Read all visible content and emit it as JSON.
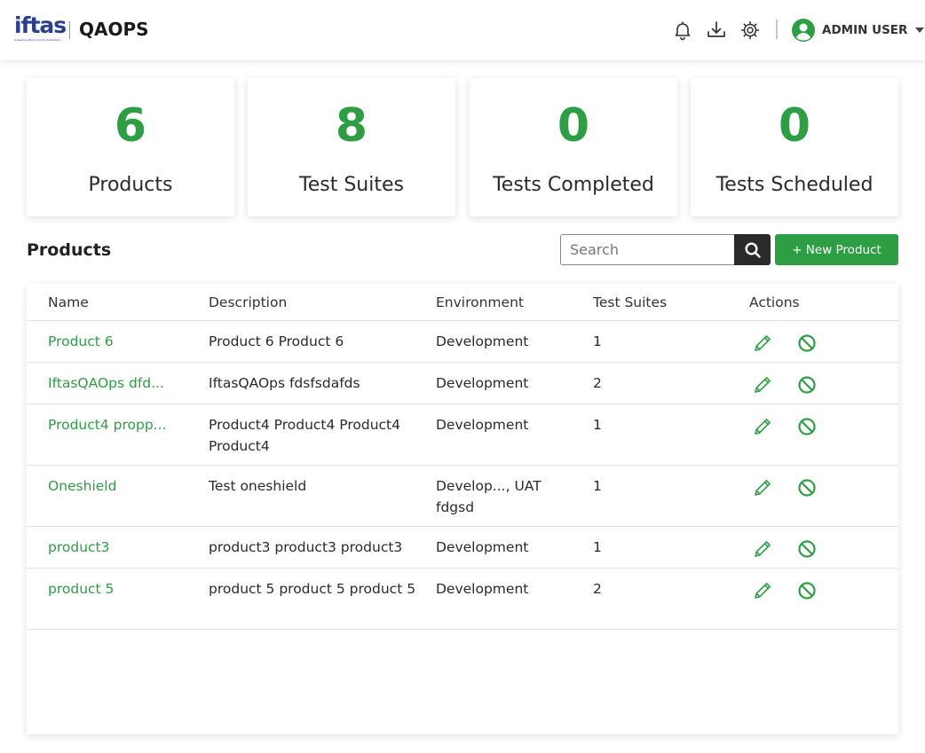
{
  "header": {
    "logo_text": "iftas",
    "logo_subtext": "A Reserve Bank of India Subsidiary",
    "app_title": "QAOPS",
    "icons": [
      "bell-icon",
      "download-icon",
      "settings-icon"
    ],
    "user_name": "ADMIN USER"
  },
  "stats": [
    {
      "value": "6",
      "label": "Products"
    },
    {
      "value": "8",
      "label": "Test Suites"
    },
    {
      "value": "0",
      "label": "Tests Completed"
    },
    {
      "value": "0",
      "label": "Tests Scheduled"
    }
  ],
  "section": {
    "title": "Products",
    "search_placeholder": "Search",
    "new_button": "+ New Product"
  },
  "table": {
    "columns": [
      "Name",
      "Description",
      "Environment",
      "Test Suites",
      "Actions"
    ],
    "rows": [
      {
        "name": "Product 6",
        "description": "Product 6 Product 6",
        "environment": "Development",
        "test_suites": "1"
      },
      {
        "name": "IftasQAOps dfd...",
        "description": "IftasQAOps fdsfsdafds",
        "environment": "Development",
        "test_suites": "2"
      },
      {
        "name": "Product4 propp...",
        "description": "Product4 Product4 Product4 Product4",
        "environment": "Development",
        "test_suites": "1"
      },
      {
        "name": "Oneshield",
        "description": "Test oneshield",
        "environment": "Develop..., UAT fdgsd",
        "test_suites": "1"
      },
      {
        "name": "product3",
        "description": "product3 product3 product3",
        "environment": "Development",
        "test_suites": "1"
      },
      {
        "name": "product 5",
        "description": "product 5 product 5 product 5",
        "environment": "Development",
        "test_suites": "2"
      }
    ]
  },
  "colors": {
    "accent": "#2e9e44",
    "brand": "#2b3f8f",
    "dark_button": "#2a2a2a"
  }
}
